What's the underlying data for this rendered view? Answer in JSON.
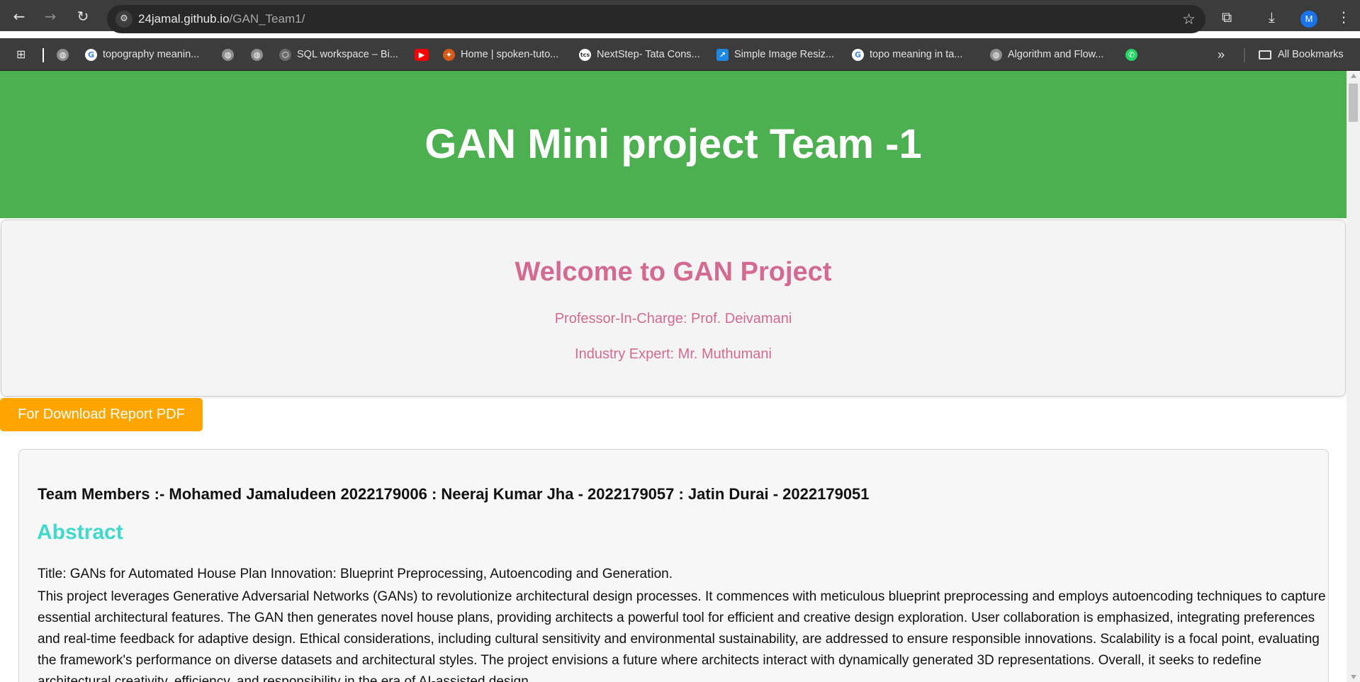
{
  "browser": {
    "url_host": "24jamal.github.io",
    "url_path": "/GAN_Team1/",
    "avatar_letter": "M",
    "bookmarks": [
      {
        "label": "topography meanin...",
        "icon": "google-icon"
      },
      {
        "label": "SQL workspace – Bi...",
        "icon": "sql-workspace-icon"
      },
      {
        "label": "Home | spoken-tuto...",
        "icon": "spoken-tutorial-icon"
      },
      {
        "label": "NextStep- Tata Cons...",
        "icon": "tcs-icon"
      },
      {
        "label": "Simple Image Resiz...",
        "icon": "image-resizer-icon"
      },
      {
        "label": "topo meaning in ta...",
        "icon": "google-icon"
      },
      {
        "label": "Algorithm and Flow...",
        "icon": "globe-icon"
      }
    ],
    "all_bookmarks_label": "All Bookmarks",
    "overflow_label": "»"
  },
  "page": {
    "hero_title": "GAN Mini project Team -1",
    "welcome_title": "Welcome to GAN Project",
    "professor": "Professor-In-Charge: Prof. Deivamani",
    "expert": "Industry Expert: Mr. Muthumani",
    "download_button": "For Download Report PDF",
    "team_members": "Team Members :- Mohamed Jamaludeen 2022179006 : Neeraj Kumar Jha - 2022179057 : Jatin Durai - 2022179051",
    "abstract_heading": "Abstract",
    "abstract_title": "Title: GANs for Automated House Plan Innovation: Blueprint Preprocessing, Autoencoding and Generation.",
    "abstract_body": "This project leverages Generative Adversarial Networks (GANs) to revolutionize architectural design processes. It commences with meticulous blueprint preprocessing and employs autoencoding techniques to capture essential architectural features. The GAN then generates novel house plans, providing architects a powerful tool for efficient and creative design exploration. User collaboration is emphasized, integrating preferences and real-time feedback for adaptive design. Ethical considerations, including cultural sensitivity and environmental sustainability, are addressed to ensure responsible innovations. Scalability is a focal point, evaluating the framework's performance on diverse datasets and architectural styles. The project envisions a future where architects interact with dynamically generated 3D representations. Overall, it seeks to redefine architectural creativity, efficiency, and responsibility in the era of AI-assisted design."
  },
  "colors": {
    "hero_bg": "#4caf50",
    "welcome_text": "#d36a8f",
    "download_button_bg": "#ffa500",
    "abstract_heading": "#40d9cc"
  }
}
